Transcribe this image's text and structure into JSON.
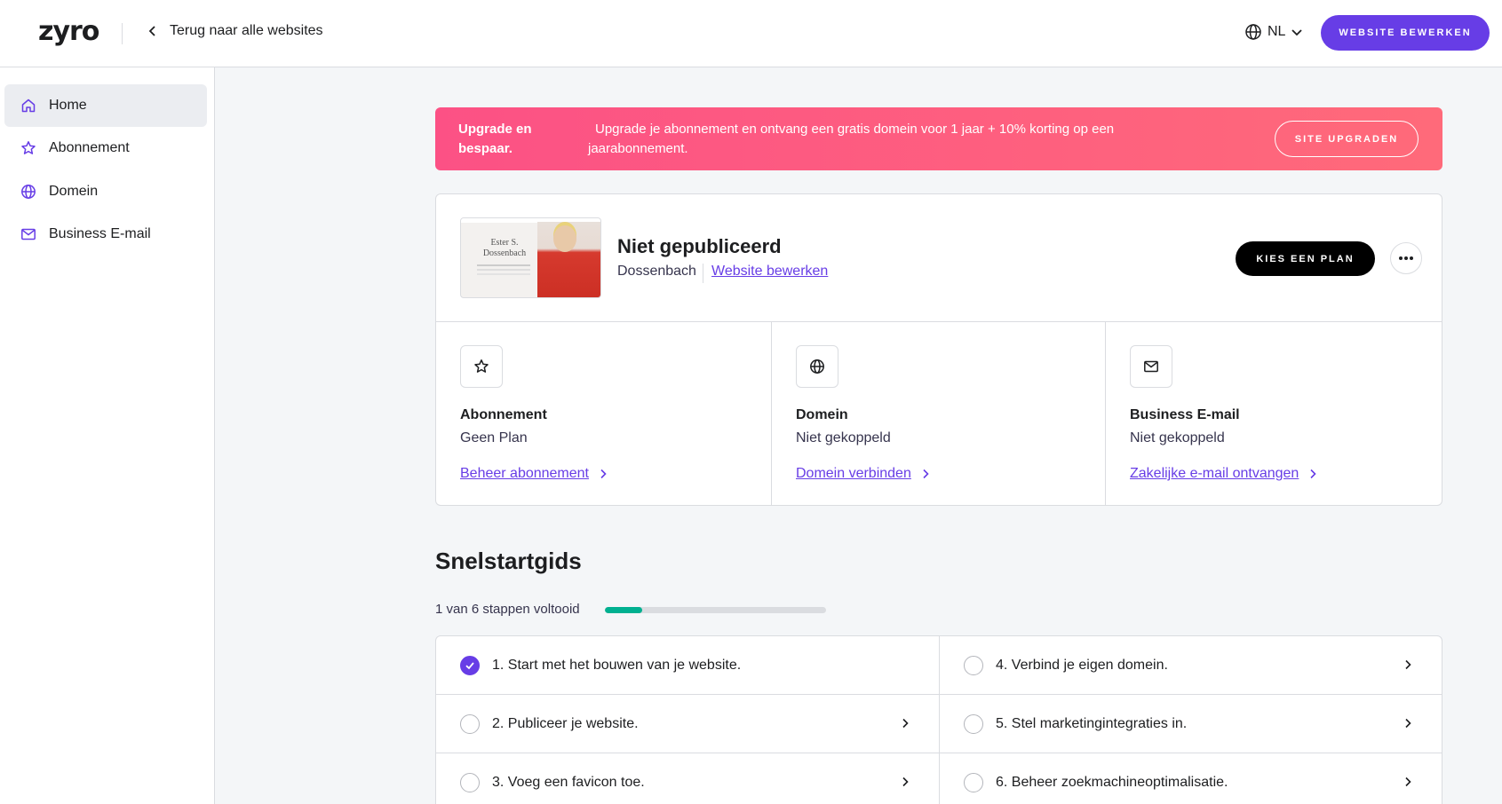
{
  "header": {
    "logo": "zyro",
    "back_label": "Terug naar alle websites",
    "language": "NL",
    "edit_button": "WEBSITE BEWERKEN"
  },
  "sidebar": {
    "items": [
      {
        "label": "Home",
        "icon": "home-icon",
        "active": true
      },
      {
        "label": "Abonnement",
        "icon": "star-icon",
        "active": false
      },
      {
        "label": "Domein",
        "icon": "globe-icon",
        "active": false
      },
      {
        "label": "Business E-mail",
        "icon": "mail-icon",
        "active": false
      }
    ]
  },
  "banner": {
    "title": "Upgrade en bespaar.",
    "text": "Upgrade je abonnement en ontvang een gratis domein voor 1 jaar + 10% korting op een jaarabonnement.",
    "button": "SITE UPGRADEN"
  },
  "site": {
    "thumbnail_name": "Ester S. Dossenbach",
    "status": "Niet gepubliceerd",
    "name": "Dossenbach",
    "edit_link": "Website bewerken",
    "plan_button": "KIES EEN PLAN"
  },
  "features": [
    {
      "title": "Abonnement",
      "subtitle": "Geen Plan",
      "link": "Beheer abonnement",
      "icon": "star-icon"
    },
    {
      "title": "Domein",
      "subtitle": "Niet gekoppeld",
      "link": "Domein verbinden",
      "icon": "globe-icon"
    },
    {
      "title": "Business E-mail",
      "subtitle": "Niet gekoppeld",
      "link": "Zakelijke e-mail ontvangen",
      "icon": "mail-icon"
    }
  ],
  "quickstart": {
    "title": "Snelstartgids",
    "progress_text": "1 van 6 stappen voltooid",
    "progress_fraction": 0.17,
    "steps": [
      {
        "label": "1. Start met het bouwen van je website.",
        "done": true
      },
      {
        "label": "2. Publiceer je website.",
        "done": false
      },
      {
        "label": "3. Voeg een favicon toe.",
        "done": false
      },
      {
        "label": "4. Verbind je eigen domein.",
        "done": false
      },
      {
        "label": "5. Stel marketingintegraties in.",
        "done": false
      },
      {
        "label": "6. Beheer zoekmachineoptimalisatie.",
        "done": false
      }
    ]
  },
  "colors": {
    "accent": "#673de6",
    "banner": "#fc5185",
    "progress": "#00b090"
  }
}
